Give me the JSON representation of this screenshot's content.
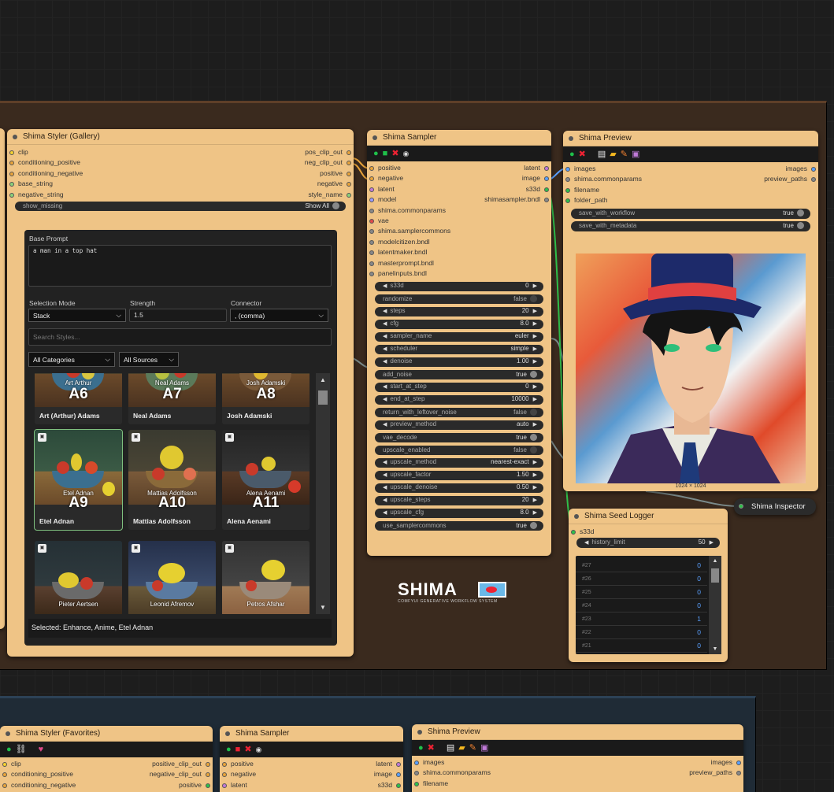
{
  "styler": {
    "title": "Shima Styler (Gallery)",
    "inputs": [
      "clip",
      "conditioning_positive",
      "conditioning_negative",
      "base_string",
      "negative_string"
    ],
    "outputs": [
      "pos_clip_out",
      "neg_clip_out",
      "positive",
      "negative",
      "style_name"
    ],
    "show_missing_label": "show_missing",
    "show_missing_value": "Show All",
    "base_prompt_label": "Base Prompt",
    "base_prompt_value": "a man in a top hat",
    "selection_mode_label": "Selection Mode",
    "selection_mode_value": "Stack",
    "strength_label": "Strength",
    "strength_value": "1.5",
    "connector_label": "Connector",
    "connector_value": ", (comma)",
    "search_placeholder": "Search Styles...",
    "category_value": "All Categories",
    "source_value": "All Sources",
    "tiles": [
      {
        "code": "A6",
        "artist": "Art Arthur",
        "name": "Art (Arthur) Adams"
      },
      {
        "code": "A7",
        "artist": "Neal Adams",
        "name": "Neal Adams"
      },
      {
        "code": "A8",
        "artist": "Josh Adamski",
        "name": "Josh Adamski"
      },
      {
        "code": "A9",
        "artist": "Etel Adnan",
        "name": "Etel Adnan"
      },
      {
        "code": "A10",
        "artist": "Mattias Adolfsson",
        "name": "Mattias Adolfsson"
      },
      {
        "code": "A11",
        "artist": "Alena Aenami",
        "name": "Alena Aenami"
      },
      {
        "code": "",
        "artist": "Pieter Aertsen",
        "name": ""
      },
      {
        "code": "",
        "artist": "Leonid Afremov",
        "name": ""
      },
      {
        "code": "",
        "artist": "Petros Afshar",
        "name": ""
      }
    ],
    "selected_text": "Selected: Enhance, Anime, Etel Adnan"
  },
  "sampler": {
    "title": "Shima Sampler",
    "io_rows": [
      {
        "in": "positive",
        "out": "latent"
      },
      {
        "in": "negative",
        "out": "image"
      },
      {
        "in": "latent",
        "out": "s33d"
      },
      {
        "in": "model",
        "out": "shimasampler.bndl"
      },
      {
        "in": "shima.commonparams",
        "out": ""
      },
      {
        "in": "vae",
        "out": ""
      },
      {
        "in": "shima.samplercommons",
        "out": ""
      },
      {
        "in": "modelcitizen.bndl",
        "out": ""
      },
      {
        "in": "latentmaker.bndl",
        "out": ""
      },
      {
        "in": "masterprompt.bndl",
        "out": ""
      },
      {
        "in": "panelinputs.bndl",
        "out": ""
      }
    ],
    "widgets": [
      {
        "label": "s33d",
        "value": "0",
        "kind": "num"
      },
      {
        "label": "randomize",
        "value": "false",
        "kind": "bool"
      },
      {
        "label": "steps",
        "value": "20",
        "kind": "num"
      },
      {
        "label": "cfg",
        "value": "8.0",
        "kind": "num"
      },
      {
        "label": "sampler_name",
        "value": "euler",
        "kind": "num"
      },
      {
        "label": "scheduler",
        "value": "simple",
        "kind": "num"
      },
      {
        "label": "denoise",
        "value": "1.00",
        "kind": "num"
      },
      {
        "label": "add_noise",
        "value": "true",
        "kind": "bool"
      },
      {
        "label": "start_at_step",
        "value": "0",
        "kind": "num"
      },
      {
        "label": "end_at_step",
        "value": "10000",
        "kind": "num"
      },
      {
        "label": "return_with_leftover_noise",
        "value": "false",
        "kind": "bool"
      },
      {
        "label": "preview_method",
        "value": "auto",
        "kind": "num"
      },
      {
        "label": "vae_decode",
        "value": "true",
        "kind": "bool"
      },
      {
        "label": "upscale_enabled",
        "value": "false",
        "kind": "bool"
      },
      {
        "label": "upscale_method",
        "value": "nearest-exact",
        "kind": "num"
      },
      {
        "label": "upscale_factor",
        "value": "1.50",
        "kind": "num"
      },
      {
        "label": "upscale_denoise",
        "value": "0.50",
        "kind": "num"
      },
      {
        "label": "upscale_steps",
        "value": "20",
        "kind": "num"
      },
      {
        "label": "upscale_cfg",
        "value": "8.0",
        "kind": "num"
      },
      {
        "label": "use_samplercommons",
        "value": "true",
        "kind": "bool"
      }
    ]
  },
  "preview": {
    "title": "Shima Preview",
    "io_rows": [
      {
        "in": "images",
        "out": "images"
      },
      {
        "in": "shima.commonparams",
        "out": "preview_paths"
      },
      {
        "in": "filename",
        "out": ""
      },
      {
        "in": "folder_path",
        "out": ""
      }
    ],
    "widgets": [
      {
        "label": "save_with_workflow",
        "value": "true"
      },
      {
        "label": "save_with_metadata",
        "value": "true"
      }
    ],
    "image_size": "1024 × 1024"
  },
  "inspector": {
    "title": "Shima Inspector"
  },
  "logger": {
    "title": "Shima Seed Logger",
    "input": "s33d",
    "history_label": "history_limit",
    "history_value": "50",
    "rows": [
      {
        "id": "#27",
        "v": "0"
      },
      {
        "id": "#26",
        "v": "0"
      },
      {
        "id": "#25",
        "v": "0"
      },
      {
        "id": "#24",
        "v": "0"
      },
      {
        "id": "#23",
        "v": "1"
      },
      {
        "id": "#22",
        "v": "0"
      },
      {
        "id": "#21",
        "v": "0"
      }
    ]
  },
  "logo": {
    "name": "SHIMA",
    "tagline": "COMFYUI GENERATIVE WORKFLOW SYSTEM"
  },
  "bottom": {
    "styler_fav_title": "Shima Styler (Favorites)",
    "styler_fav_inputs": [
      "clip",
      "conditioning_positive",
      "conditioning_negative"
    ],
    "styler_fav_outputs": [
      "positive_clip_out",
      "negative_clip_out",
      "positive"
    ],
    "sampler_title": "Shima Sampler",
    "sampler_rows": [
      {
        "in": "positive",
        "out": "latent"
      },
      {
        "in": "negative",
        "out": "image"
      },
      {
        "in": "latent",
        "out": "s33d"
      }
    ],
    "preview_title": "Shima Preview",
    "preview_rows": [
      {
        "in": "images",
        "out": "images"
      },
      {
        "in": "shima.commonparams",
        "out": "preview_paths"
      },
      {
        "in": "filename",
        "out": ""
      }
    ]
  },
  "colors": {
    "node": "#efc486",
    "group_top": "#3a2a1e",
    "group_bottom": "#1f2b36",
    "accent_blue": "#5aa0ff"
  }
}
